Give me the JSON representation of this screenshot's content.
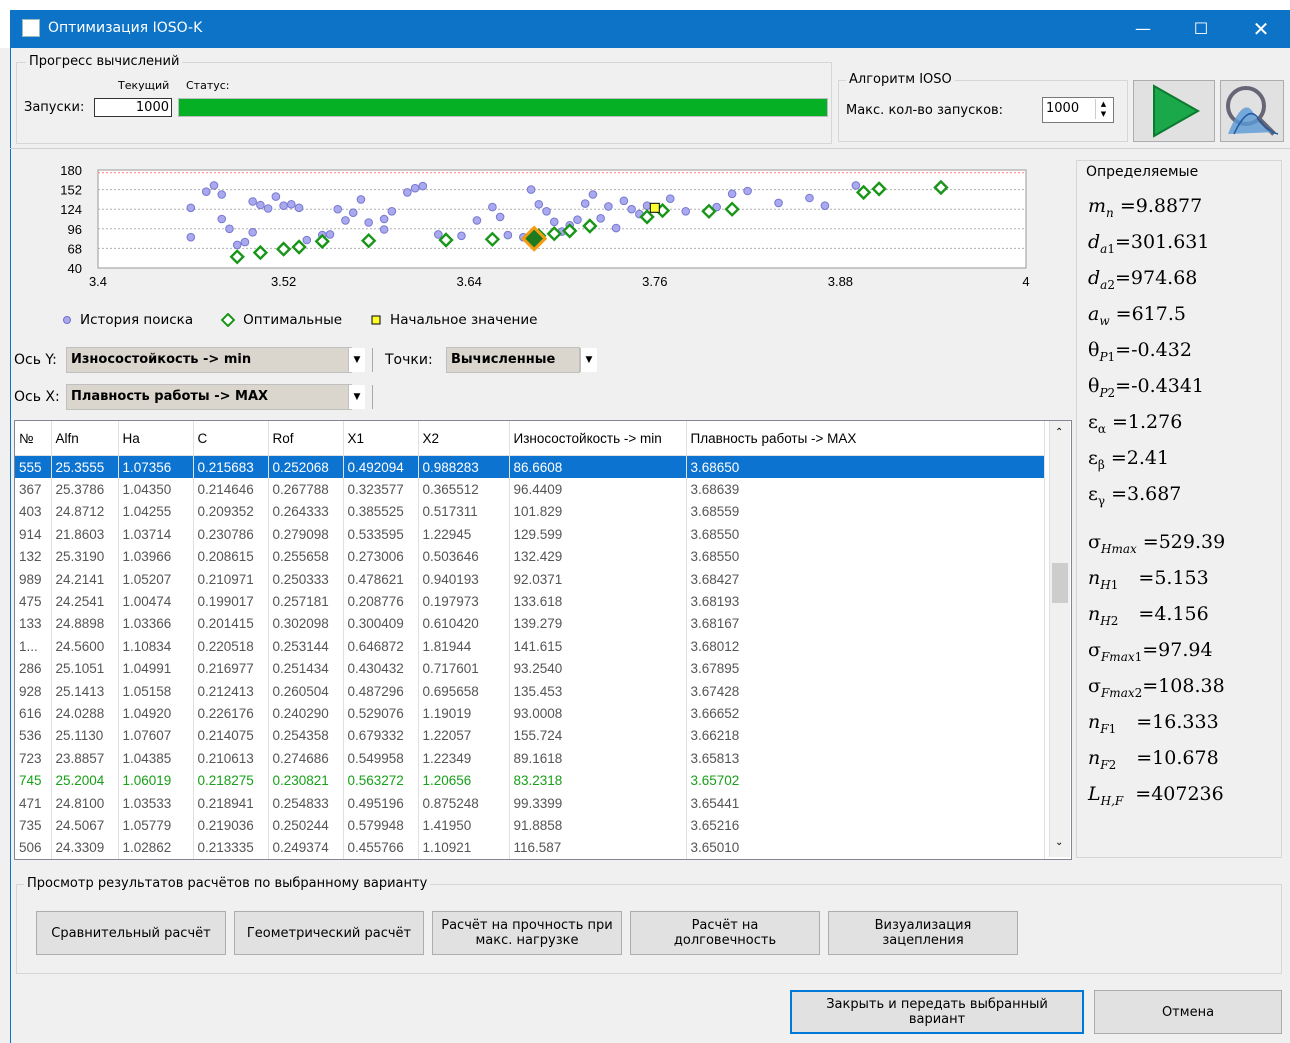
{
  "window": {
    "title": "Оптимизация IOSO-K",
    "minimize_icon": "minimize-icon",
    "maximize_icon": "maximize-icon",
    "close_icon": "close-icon"
  },
  "progress": {
    "group_label": "Прогресс вычислений",
    "current_label": "Текущий",
    "status_label": "Статус:",
    "runs_label": "Запуски:",
    "runs_value": "1000",
    "progress_fraction": 1.0,
    "bar_color": "#06b025"
  },
  "algorithm": {
    "group_label": "Алгоритм IOSO",
    "max_runs_label": "Макс. кол-во запусков:",
    "max_runs_value": "1000",
    "run_icon": "play-icon",
    "visualize_icon": "surface-plot-icon"
  },
  "chart_data": {
    "type": "scatter",
    "y_ticks": [
      "180",
      "152",
      "124",
      "96",
      "68",
      "40"
    ],
    "x_ticks": [
      "3.4",
      "3.52",
      "3.64",
      "3.76",
      "3.88",
      "4"
    ],
    "xlim": [
      3.4,
      4.0
    ],
    "ylim": [
      40,
      180
    ],
    "grid": true,
    "legend_position": "bottom",
    "series": [
      {
        "name": "История поиска",
        "marker": "circle",
        "color": "#8e8ee6",
        "points": [
          [
            3.46,
            84
          ],
          [
            3.46,
            126
          ],
          [
            3.47,
            149
          ],
          [
            3.475,
            158
          ],
          [
            3.48,
            145
          ],
          [
            3.48,
            110
          ],
          [
            3.485,
            96
          ],
          [
            3.49,
            58
          ],
          [
            3.49,
            73
          ],
          [
            3.495,
            77
          ],
          [
            3.5,
            91
          ],
          [
            3.5,
            135
          ],
          [
            3.505,
            130
          ],
          [
            3.51,
            125
          ],
          [
            3.515,
            142
          ],
          [
            3.52,
            129
          ],
          [
            3.525,
            131
          ],
          [
            3.53,
            126
          ],
          [
            3.535,
            80
          ],
          [
            3.545,
            87
          ],
          [
            3.55,
            88
          ],
          [
            3.555,
            124
          ],
          [
            3.56,
            108
          ],
          [
            3.565,
            119
          ],
          [
            3.57,
            138
          ],
          [
            3.575,
            105
          ],
          [
            3.585,
            95
          ],
          [
            3.585,
            110
          ],
          [
            3.59,
            121
          ],
          [
            3.6,
            148
          ],
          [
            3.605,
            154
          ],
          [
            3.61,
            157
          ],
          [
            3.62,
            88
          ],
          [
            3.635,
            86
          ],
          [
            3.645,
            108
          ],
          [
            3.655,
            127
          ],
          [
            3.66,
            113
          ],
          [
            3.665,
            87
          ],
          [
            3.675,
            84
          ],
          [
            3.68,
            152
          ],
          [
            3.685,
            131
          ],
          [
            3.69,
            121
          ],
          [
            3.695,
            106
          ],
          [
            3.7,
            92
          ],
          [
            3.705,
            101
          ],
          [
            3.71,
            109
          ],
          [
            3.715,
            132
          ],
          [
            3.72,
            145
          ],
          [
            3.725,
            111
          ],
          [
            3.73,
            128
          ],
          [
            3.735,
            97
          ],
          [
            3.74,
            136
          ],
          [
            3.745,
            124
          ],
          [
            3.75,
            117
          ],
          [
            3.755,
            129
          ],
          [
            3.77,
            139
          ],
          [
            3.78,
            121
          ],
          [
            3.8,
            127
          ],
          [
            3.81,
            146
          ],
          [
            3.82,
            150
          ],
          [
            3.84,
            133
          ],
          [
            3.86,
            140
          ],
          [
            3.87,
            129
          ],
          [
            3.89,
            158
          ],
          [
            3.905,
            152
          ]
        ]
      },
      {
        "name": "Оптимальные",
        "marker": "diamond",
        "color": "#199619",
        "points": [
          [
            3.49,
            56
          ],
          [
            3.505,
            62
          ],
          [
            3.52,
            67
          ],
          [
            3.53,
            70
          ],
          [
            3.545,
            78
          ],
          [
            3.575,
            79
          ],
          [
            3.625,
            80
          ],
          [
            3.655,
            81
          ],
          [
            3.685,
            86
          ],
          [
            3.695,
            89
          ],
          [
            3.705,
            93
          ],
          [
            3.718,
            100
          ],
          [
            3.755,
            113
          ],
          [
            3.765,
            122
          ],
          [
            3.795,
            121
          ],
          [
            3.81,
            124
          ],
          [
            3.895,
            148
          ],
          [
            3.905,
            153
          ],
          [
            3.945,
            155
          ]
        ]
      },
      {
        "name": "Начальное значение",
        "marker": "square",
        "color": "#e8e800",
        "points": [
          [
            3.76,
            126
          ]
        ]
      }
    ],
    "highlight_point": [
      3.682,
      82
    ]
  },
  "legend": {
    "history": "История поиска",
    "optimal": "Оптимальные",
    "initial": "Начальное значение"
  },
  "axes": {
    "y_label": "Ось Y:",
    "y_value": "Износостойкость -> min",
    "points_label": "Точки:",
    "points_value": "Вычисленные",
    "x_label": "Ось X:",
    "x_value": "Плавность работы -> MAX"
  },
  "table": {
    "headers": [
      "№",
      "Alfn",
      "Ha",
      "C",
      "Rof",
      "X1",
      "X2",
      "Износостойкость -> min",
      "Плавность работы -> MAX"
    ],
    "rows": [
      [
        "555",
        "25.3555",
        "1.07356",
        "0.215683",
        "0.252068",
        "0.492094",
        "0.988283",
        "86.6608",
        "3.68650"
      ],
      [
        "367",
        "25.3786",
        "1.04350",
        "0.214646",
        "0.267788",
        "0.323577",
        "0.365512",
        "96.4409",
        "3.68639"
      ],
      [
        "403",
        "24.8712",
        "1.04255",
        "0.209352",
        "0.264333",
        "0.385525",
        "0.517311",
        "101.829",
        "3.68559"
      ],
      [
        "914",
        "21.8603",
        "1.03714",
        "0.230786",
        "0.279098",
        "0.533595",
        "1.22945",
        "129.599",
        "3.68550"
      ],
      [
        "132",
        "25.3190",
        "1.03966",
        "0.208615",
        "0.255658",
        "0.273006",
        "0.503646",
        "132.429",
        "3.68550"
      ],
      [
        "989",
        "24.2141",
        "1.05207",
        "0.210971",
        "0.250333",
        "0.478621",
        "0.940193",
        "92.0371",
        "3.68427"
      ],
      [
        "475",
        "24.2541",
        "1.00474",
        "0.199017",
        "0.257181",
        "0.208776",
        "0.197973",
        "133.618",
        "3.68193"
      ],
      [
        "133",
        "24.8898",
        "1.03366",
        "0.201415",
        "0.302098",
        "0.300409",
        "0.610420",
        "139.279",
        "3.68167"
      ],
      [
        "1...",
        "24.5600",
        "1.10834",
        "0.220518",
        "0.253144",
        "0.646872",
        "1.81944",
        "141.615",
        "3.68012"
      ],
      [
        "286",
        "25.1051",
        "1.04991",
        "0.216977",
        "0.251434",
        "0.430432",
        "0.717601",
        "93.2540",
        "3.67895"
      ],
      [
        "928",
        "25.1413",
        "1.05158",
        "0.212413",
        "0.260504",
        "0.487296",
        "0.695658",
        "135.453",
        "3.67428"
      ],
      [
        "616",
        "24.0288",
        "1.04920",
        "0.226176",
        "0.240290",
        "0.529076",
        "1.19019",
        "93.0008",
        "3.66652"
      ],
      [
        "536",
        "25.1130",
        "1.07607",
        "0.214075",
        "0.254358",
        "0.679332",
        "1.22057",
        "155.724",
        "3.66218"
      ],
      [
        "723",
        "23.8857",
        "1.04385",
        "0.210613",
        "0.274686",
        "0.549958",
        "1.22349",
        "89.1618",
        "3.65813"
      ],
      [
        "745",
        "25.2004",
        "1.06019",
        "0.218275",
        "0.230821",
        "0.563272",
        "1.20656",
        "83.2318",
        "3.65702"
      ],
      [
        "471",
        "24.8100",
        "1.03533",
        "0.218941",
        "0.254833",
        "0.495196",
        "0.875248",
        "99.3399",
        "3.65441"
      ],
      [
        "735",
        "24.5067",
        "1.05779",
        "0.219036",
        "0.250244",
        "0.579948",
        "1.41950",
        "91.8858",
        "3.65216"
      ],
      [
        "506",
        "24.3309",
        "1.02862",
        "0.213335",
        "0.249374",
        "0.455766",
        "1.10921",
        "116.587",
        "3.65010"
      ]
    ]
  },
  "params": {
    "group_label": "Определяемые",
    "m_n": "=9.8877",
    "d_a1": "=301.631",
    "d_a2": "=974.68",
    "a_w": "=617.5",
    "theta_p1": "=-0.432",
    "theta_p2": "=-0.4341",
    "eps_alpha": "=1.276",
    "eps_beta": "=2.41",
    "eps_gamma": "=3.687",
    "sigma_hmax": "=529.39",
    "n_h1": "=5.153",
    "n_h2": "=4.156",
    "sigma_fmax1": "=97.94",
    "sigma_fmax2": "=108.38",
    "n_f1": "=16.333",
    "n_f2": "=10.678",
    "l_hf": "=407236"
  },
  "results": {
    "group_label": "Просмотр результатов расчётов по выбранному варианту",
    "compare": "Сравнительный расчёт",
    "geometry": "Геометрический расчёт",
    "strength_1": "Расчёт на прочность при",
    "strength_2": "макс. нагрузке",
    "durability_1": "Расчёт на",
    "durability_2": "долговечность",
    "visual_1": "Визуализация",
    "visual_2": "зацепления"
  },
  "footer": {
    "ok_1": "Закрыть и передать выбранный",
    "ok_2": "вариант",
    "cancel": "Отмена"
  }
}
